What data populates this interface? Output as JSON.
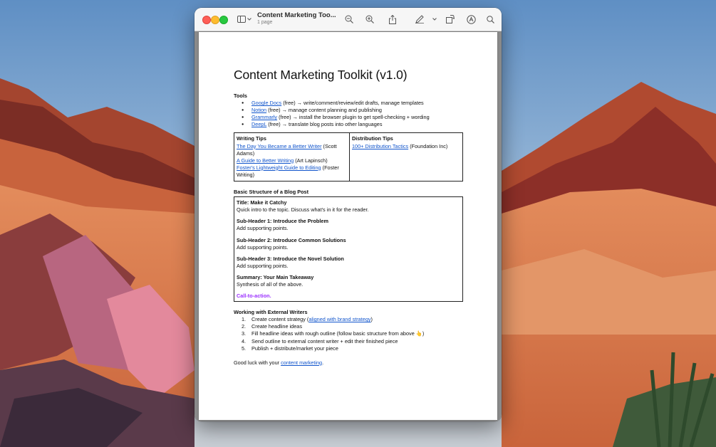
{
  "window": {
    "title": "Content Marketing Too...",
    "subtitle": "1 page"
  },
  "toolbar_icons": [
    "sidebar-icon",
    "chevron-down-icon",
    "zoom-out-icon",
    "zoom-in-icon",
    "share-icon",
    "markup-pen-icon",
    "rotate-icon",
    "markup-circle-icon",
    "search-icon"
  ],
  "document": {
    "heading": "Content Marketing Toolkit (v1.0)",
    "tools_label": "Tools",
    "tools": [
      {
        "link": "Google Docs",
        "rest": " (free) → write/comment/review/edit drafts, manage templates"
      },
      {
        "link": "Notion",
        "rest": " (free) → manage content planning and publishing"
      },
      {
        "link": "Grammarly",
        "rest": " (free) → install the browser plugin to get spell-checking + wording"
      },
      {
        "link": "DeepL",
        "rest": " (free) → translate blog posts into other languages"
      }
    ],
    "writing_tips": {
      "title": "Writing Tips",
      "items": [
        {
          "link": "The Day You Became a Better Writer",
          "rest": " (Scott Adams)"
        },
        {
          "link": "A Guide to Better Writing",
          "rest": " (Art Lapinsch)"
        },
        {
          "link": "Foster's Lightweight Guide to Editing",
          "rest": " (Foster Writing)"
        }
      ]
    },
    "distribution_tips": {
      "title": "Distribution Tips",
      "link": "100+ Distribution Tactics",
      "rest": " (Foundation Inc)"
    },
    "structure_label": "Basic Structure of a Blog Post",
    "structure": [
      {
        "head": "Title: Make it Catchy",
        "body": "Quick intro to the topic. Discuss what's in it for the reader."
      },
      {
        "head": "Sub-Header 1: Introduce the Problem",
        "body": "Add supporting points."
      },
      {
        "head": "Sub-Header 2: Introduce Common Solutions",
        "body": "Add supporting points."
      },
      {
        "head": "Sub-Header 3: Introduce the Novel Solution",
        "body": "Add supporting points."
      },
      {
        "head": "Summary: Your Main Takeaway",
        "body": "Synthesis of all of the above."
      }
    ],
    "cta": "Call-to-action.",
    "external_label": "Working with External Writers",
    "steps": [
      {
        "num": "1.",
        "pre": "Create content strategy (",
        "link": "aligned with brand strategy",
        "post": ")"
      },
      {
        "num": "2.",
        "pre": "Create headline ideas",
        "link": "",
        "post": ""
      },
      {
        "num": "3.",
        "pre": "Fill headline ideas with rough outline (follow basic structure from above 👆)",
        "link": "",
        "post": ""
      },
      {
        "num": "4.",
        "pre": "Send outline to external content writer + edit their finished piece",
        "link": "",
        "post": ""
      },
      {
        "num": "5.",
        "pre": "Publish + distribute/market your piece",
        "link": "",
        "post": ""
      }
    ],
    "closing_pre": "Good luck with your ",
    "closing_link": "content marketing",
    "closing_post": "."
  },
  "colors": {
    "link": "#1155cc",
    "cta": "#9b30ff",
    "close": "#fe5f57",
    "minimize": "#febc2e",
    "maximize": "#28c840"
  }
}
